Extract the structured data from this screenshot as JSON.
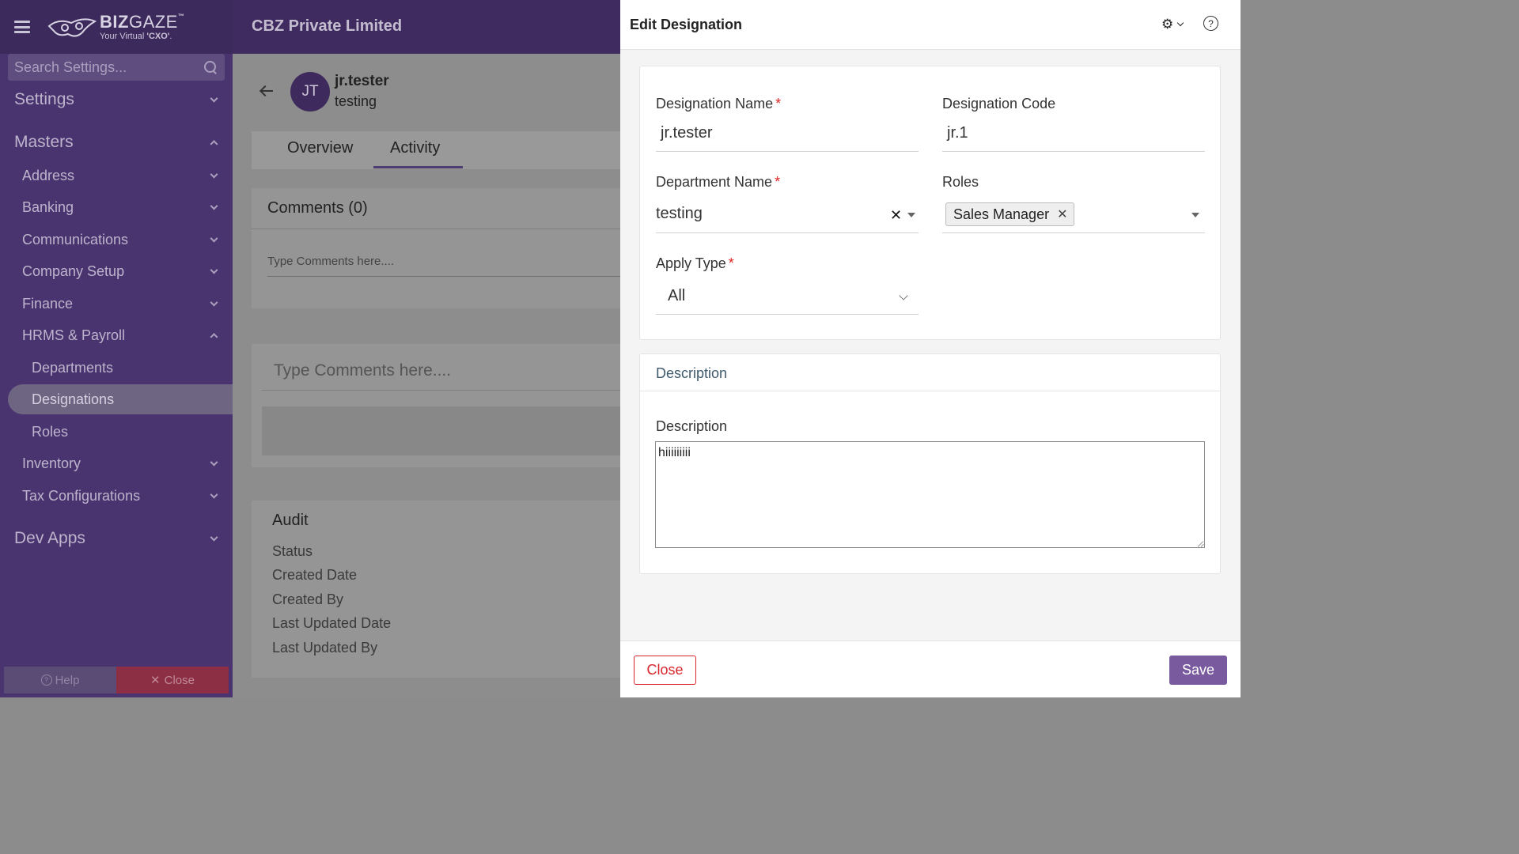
{
  "brand": {
    "name_bold": "BIZ",
    "name_thin": "GAZE",
    "tm": "™",
    "tagline_pre": "Your Virtual ",
    "tagline_bold": "'CXO'",
    "tagline_post": "."
  },
  "company": "CBZ Private Limited",
  "sidebar": {
    "search_placeholder": "Search Settings...",
    "items": [
      {
        "label": "Settings",
        "level": 0,
        "chevron": "down"
      },
      {
        "label": "Masters",
        "level": 0,
        "chevron": "up"
      },
      {
        "label": "Address",
        "level": 1,
        "chevron": "down"
      },
      {
        "label": "Banking",
        "level": 1,
        "chevron": "down"
      },
      {
        "label": "Communications",
        "level": 1,
        "chevron": "down"
      },
      {
        "label": "Company Setup",
        "level": 1,
        "chevron": "down"
      },
      {
        "label": "Finance",
        "level": 1,
        "chevron": "down"
      },
      {
        "label": "HRMS & Payroll",
        "level": 1,
        "chevron": "up"
      },
      {
        "label": "Departments",
        "level": 2
      },
      {
        "label": "Designations",
        "level": 2,
        "active": true
      },
      {
        "label": "Roles",
        "level": 2
      },
      {
        "label": "Inventory",
        "level": 1,
        "chevron": "down"
      },
      {
        "label": "Tax Configurations",
        "level": 1,
        "chevron": "down"
      },
      {
        "label": "Dev Apps",
        "level": 0,
        "chevron": "down"
      }
    ],
    "help_label": "Help",
    "close_label": "Close"
  },
  "record": {
    "avatar_initials": "JT",
    "name": "jr.tester",
    "subtitle": "testing",
    "tabs": [
      "Overview",
      "Activity"
    ],
    "active_tab": "Activity",
    "comments_title": "Comments (0)",
    "comments_placeholder": "Type Comments here....",
    "comment_box_placeholder": "Type Comments here....",
    "audit_title": "Audit",
    "audit_fields": [
      "Status",
      "Created Date",
      "Created By",
      "Last Updated Date",
      "Last Updated By"
    ]
  },
  "panel": {
    "title": "Edit Designation",
    "help_glyph": "?",
    "fields": {
      "designation_name_label": "Designation Name",
      "designation_name_value": "jr.tester",
      "designation_code_label": "Designation Code",
      "designation_code_value": "jr.1",
      "department_name_label": "Department Name",
      "department_name_value": "testing",
      "roles_label": "Roles",
      "roles_selected": [
        "Sales Manager"
      ],
      "apply_type_label": "Apply Type",
      "apply_type_value": "All",
      "required_mark": "*"
    },
    "description_section": "Description",
    "description_label": "Description",
    "description_value": "hiiiiiiiii",
    "close_label": "Close",
    "save_label": "Save"
  },
  "colors": {
    "sidebar_bg": "#4a3470",
    "accent": "#7a5a9e",
    "danger": "#d9272e",
    "required": "#e02424"
  }
}
